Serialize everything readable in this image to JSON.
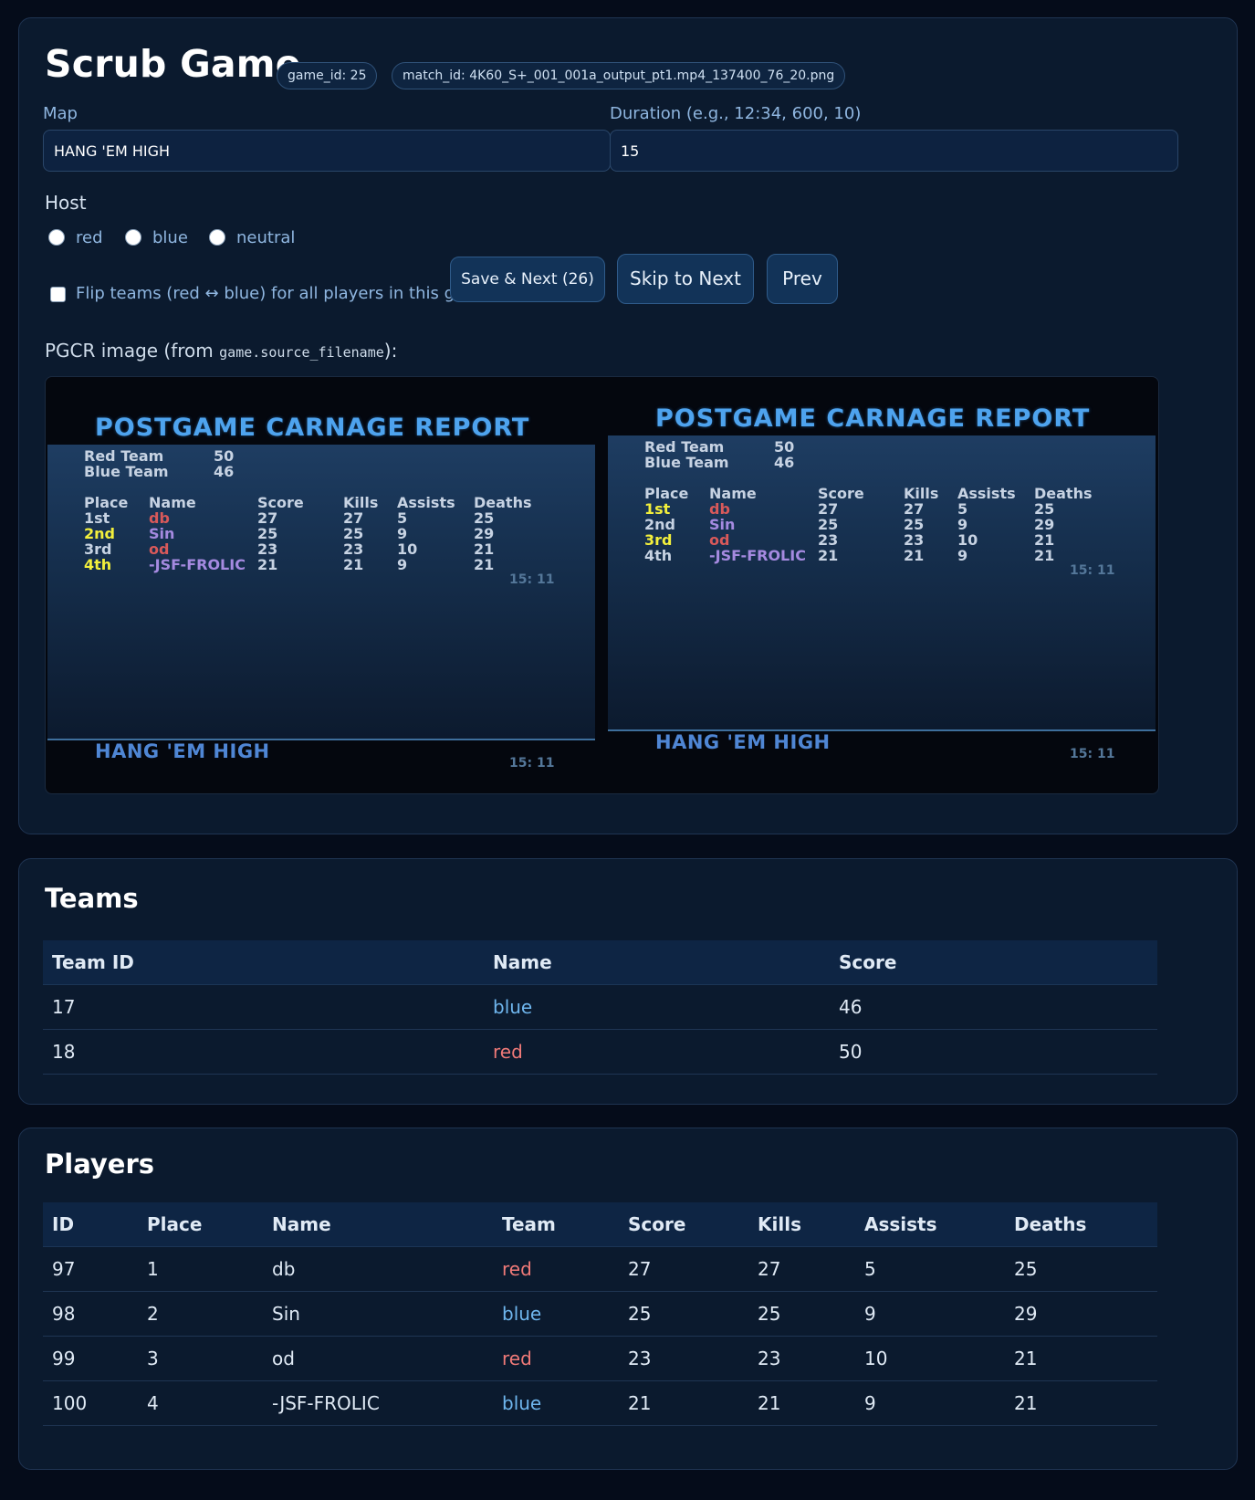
{
  "header": {
    "title": "Scrub Game",
    "game_id_badge": "game_id: 25",
    "match_id_badge": "match_id: 4K60_S+_001_001a_output_pt1.mp4_137400_76_20.png"
  },
  "form": {
    "map_label": "Map",
    "map_value": "HANG 'EM HIGH",
    "duration_label": "Duration (e.g., 12:34, 600, 10)",
    "duration_value": "15",
    "host_label": "Host",
    "host_options": [
      "red",
      "blue",
      "neutral"
    ],
    "flip_label": "Flip teams (red ↔ blue) for all players in this game",
    "save_button": "Save & Next (26)",
    "skip_button": "Skip to Next",
    "prev_button": "Prev",
    "pgcr_caption_prefix": "PGCR image (from ",
    "pgcr_caption_code": "game.source_filename",
    "pgcr_caption_suffix": "):"
  },
  "pgcr": {
    "title": "POSTGAME CARNAGE REPORT",
    "red_team_label": "Red Team",
    "red_team_score": "50",
    "blue_team_label": "Blue Team",
    "blue_team_score": "46",
    "headers": [
      "Place",
      "Name",
      "Score",
      "Kills",
      "Assists",
      "Deaths"
    ],
    "rows": [
      {
        "place": "1st",
        "name": "db",
        "score": "27",
        "kills": "27",
        "assists": "5",
        "deaths": "25"
      },
      {
        "place": "2nd",
        "name": "Sin",
        "score": "25",
        "kills": "25",
        "assists": "9",
        "deaths": "29"
      },
      {
        "place": "3rd",
        "name": "od",
        "score": "23",
        "kills": "23",
        "assists": "10",
        "deaths": "21"
      },
      {
        "place": "4th",
        "name": "-JSF-FROLIC",
        "score": "21",
        "kills": "21",
        "assists": "9",
        "deaths": "21"
      }
    ],
    "time": "15: 11",
    "map": "HANG 'EM HIGH",
    "colors": {
      "red": "#d8595a",
      "blue": "#a58ae0",
      "highlight": "#f2ef3c"
    }
  },
  "teams": {
    "heading": "Teams",
    "columns": [
      "Team ID",
      "Name",
      "Score"
    ],
    "rows": [
      {
        "id": "17",
        "name": "blue",
        "score": "46"
      },
      {
        "id": "18",
        "name": "red",
        "score": "50"
      }
    ]
  },
  "players": {
    "heading": "Players",
    "columns": [
      "ID",
      "Place",
      "Name",
      "Team",
      "Score",
      "Kills",
      "Assists",
      "Deaths"
    ],
    "rows": [
      {
        "id": "97",
        "place": "1",
        "name": "db",
        "team": "red",
        "score": "27",
        "kills": "27",
        "assists": "5",
        "deaths": "25"
      },
      {
        "id": "98",
        "place": "2",
        "name": "Sin",
        "team": "blue",
        "score": "25",
        "kills": "25",
        "assists": "9",
        "deaths": "29"
      },
      {
        "id": "99",
        "place": "3",
        "name": "od",
        "team": "red",
        "score": "23",
        "kills": "23",
        "assists": "10",
        "deaths": "21"
      },
      {
        "id": "100",
        "place": "4",
        "name": "-JSF-FROLIC",
        "team": "blue",
        "score": "21",
        "kills": "21",
        "assists": "9",
        "deaths": "21"
      }
    ]
  },
  "theme": {
    "accent": "#8fb6e0",
    "team_red": "#f07a78",
    "team_blue": "#6fb6ee",
    "background": "#050c1a"
  }
}
